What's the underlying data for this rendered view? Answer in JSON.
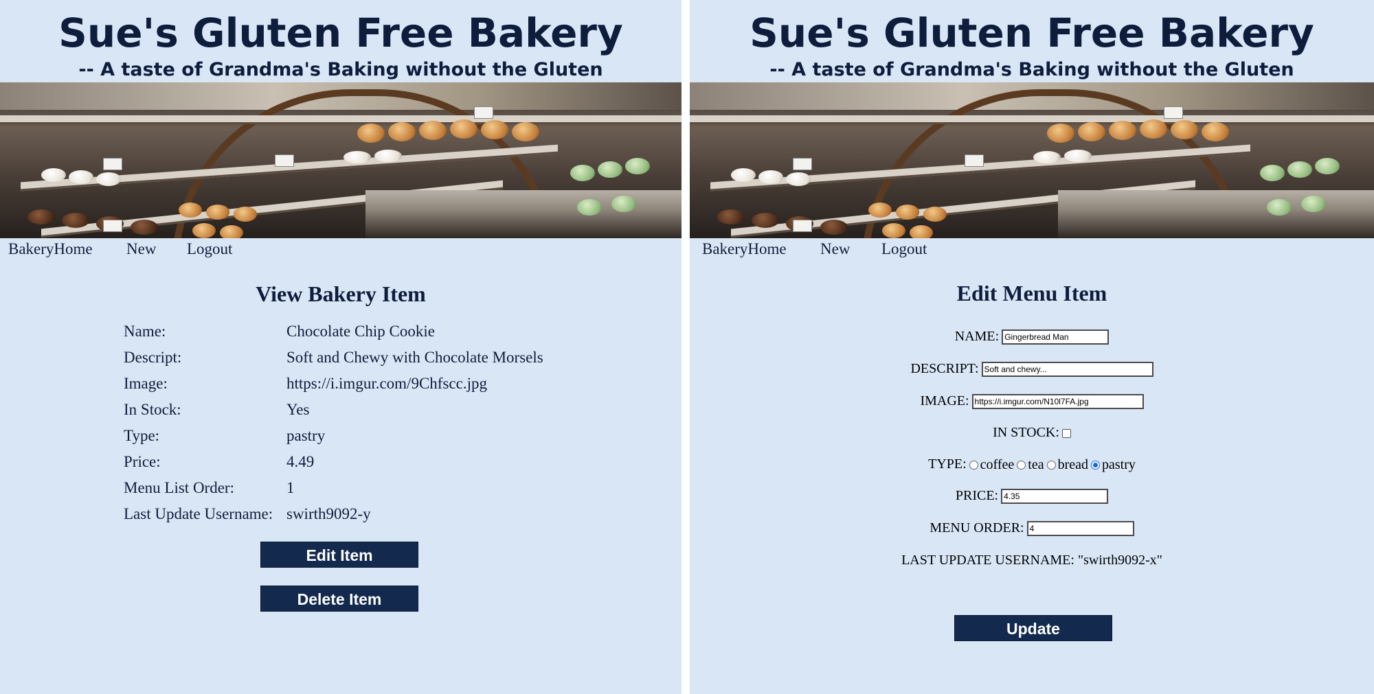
{
  "site": {
    "title": "Sue's Gluten Free Bakery",
    "tagline": "-- A taste of Grandma's Baking without the Gluten"
  },
  "nav": {
    "home": "BakeryHome",
    "new": "New",
    "logout": "Logout"
  },
  "view_page": {
    "heading": "View Bakery Item",
    "rows": [
      {
        "label": "Name:",
        "value": "Chocolate Chip Cookie"
      },
      {
        "label": "Descript:",
        "value": "Soft and Chewy with Chocolate Morsels"
      },
      {
        "label": "Image:",
        "value": "https://i.imgur.com/9Chfscc.jpg"
      },
      {
        "label": "In Stock:",
        "value": "Yes"
      },
      {
        "label": "Type:",
        "value": "pastry"
      },
      {
        "label": "Price:",
        "value": "4.49"
      },
      {
        "label": "Menu List Order:",
        "value": "1"
      },
      {
        "label": "Last Update Username:",
        "value": "swirth9092-y"
      }
    ],
    "edit_button": "Edit Item",
    "delete_button": "Delete Item"
  },
  "edit_page": {
    "heading": "Edit Menu Item",
    "name_label": "NAME:",
    "name_value": "Gingerbread Man",
    "descript_label": "DESCRIPT:",
    "descript_value": "Soft and chewy...",
    "image_label": "IMAGE:",
    "image_value": "https://i.imgur.com/N10l7FA.jpg",
    "in_stock_label": "IN STOCK:",
    "in_stock_checked": false,
    "type_label": "TYPE:",
    "type_options": [
      "coffee",
      "tea",
      "bread",
      "pastry"
    ],
    "type_selected": "pastry",
    "price_label": "PRICE:",
    "price_value": "4.35",
    "menu_order_label": "MENU ORDER:",
    "menu_order_value": "4",
    "last_update_text": "LAST UPDATE USERNAME: \"swirth9092-x\"",
    "update_button": "Update"
  },
  "colors": {
    "page_background": "#d9e6f6",
    "text": "#0f1d3c",
    "button": "#13294e",
    "radio_selected": "#1a66d9"
  }
}
